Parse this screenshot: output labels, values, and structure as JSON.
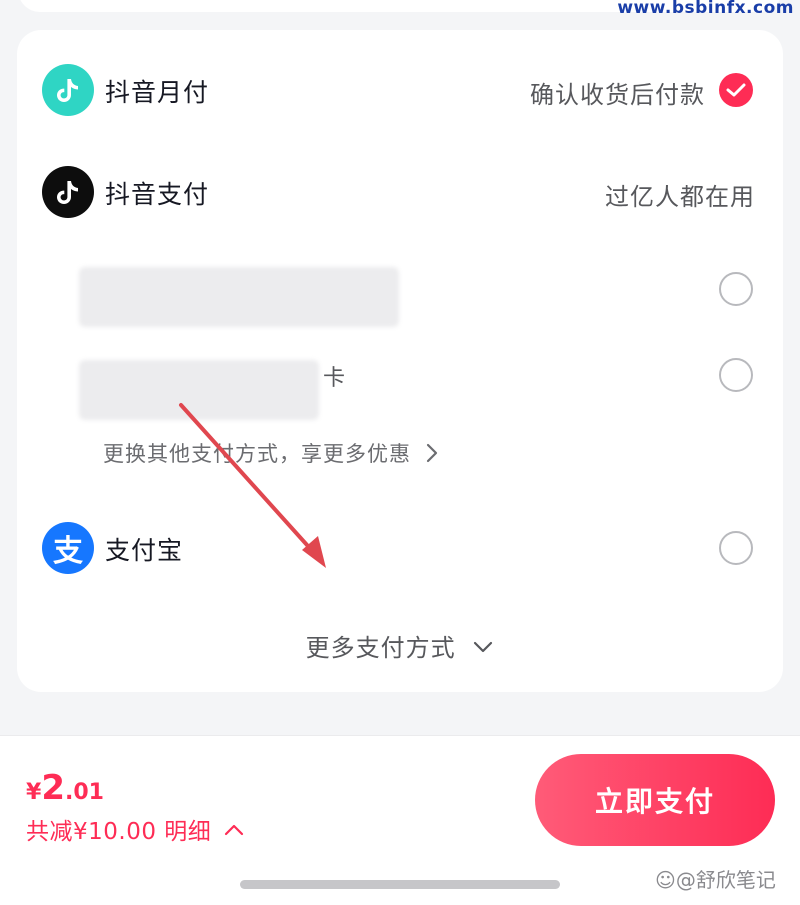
{
  "watermark_url": "www.bsbinfx.com",
  "payment_methods": {
    "douyin_monthly": {
      "label": "抖音月付",
      "hint": "确认收货后付款",
      "selected": true
    },
    "douyin_pay": {
      "label": "抖音支付",
      "hint": "过亿人都在用"
    },
    "card_suffix_glyph": "卡",
    "switch_link": "更换其他支付方式，享更多优惠",
    "alipay": {
      "label": "支付宝",
      "icon_glyph": "支"
    },
    "more_methods": "更多支付方式"
  },
  "footer": {
    "currency": "¥",
    "price_integer": "2",
    "price_decimal": ".01",
    "discount_text": "共减¥10.00 明细",
    "pay_button": "立即支付",
    "watermark": "舒欣笔记"
  },
  "colors": {
    "accent": "#fe2c55",
    "alipay": "#1677ff",
    "monthly": "#2fd5c4"
  },
  "icons": {
    "douyin_monthly": "douyin-icon",
    "douyin_pay": "douyin-icon",
    "alipay": "alipay-icon",
    "check": "check-icon",
    "chevron_right": "chevron-right-icon",
    "chevron_down": "chevron-down-icon",
    "chevron_up": "chevron-up-icon"
  }
}
